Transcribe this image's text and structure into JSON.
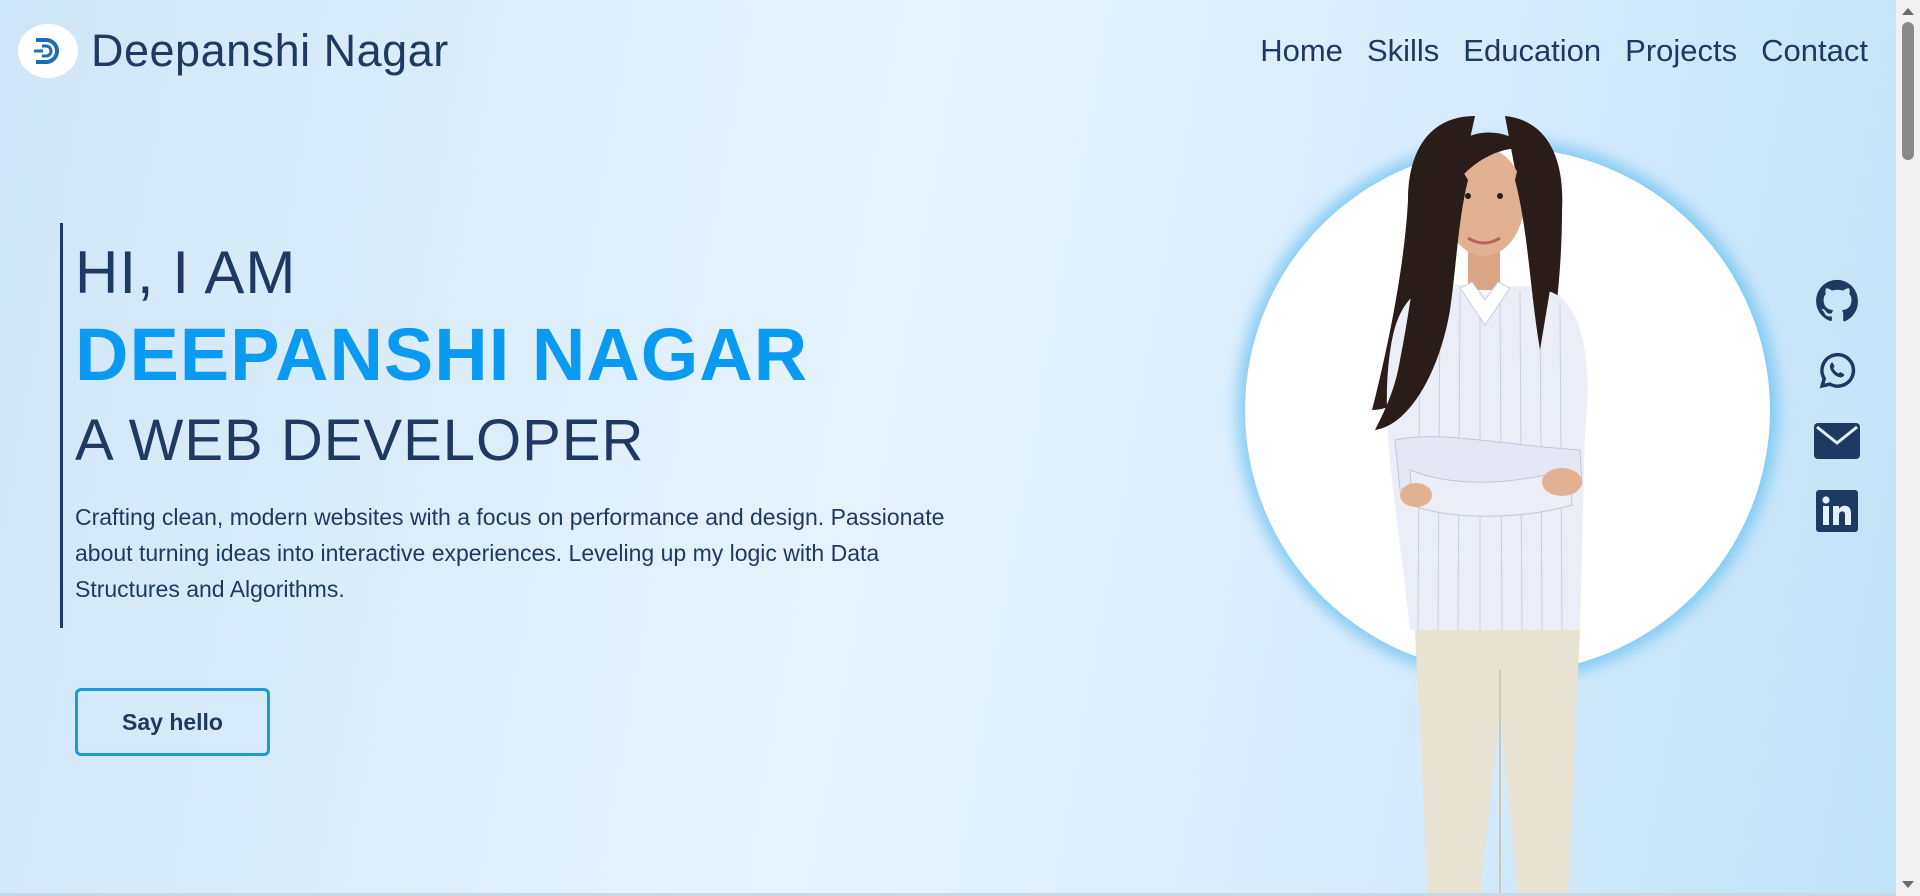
{
  "header": {
    "brand_name": "Deepanshi Nagar",
    "logo_icon": "d-monogram-logo-icon",
    "nav": [
      {
        "label": "Home"
      },
      {
        "label": "Skills"
      },
      {
        "label": "Education"
      },
      {
        "label": "Projects"
      },
      {
        "label": "Contact"
      }
    ]
  },
  "hero": {
    "greeting": "HI, I AM",
    "name": "DEEPANSHI NAGAR",
    "role": "A WEB DEVELOPER",
    "description": "Crafting clean, modern websites with a focus on performance and design. Passionate about turning ideas into interactive experiences. Leveling up my logic with Data Structures and Algorithms.",
    "cta_label": "Say hello"
  },
  "social": [
    {
      "icon": "github-icon"
    },
    {
      "icon": "whatsapp-icon"
    },
    {
      "icon": "email-icon"
    },
    {
      "icon": "linkedin-icon"
    }
  ],
  "colors": {
    "primary_text": "#1f3a62",
    "accent": "#0b9af1",
    "button_border": "#1a9ad9"
  }
}
